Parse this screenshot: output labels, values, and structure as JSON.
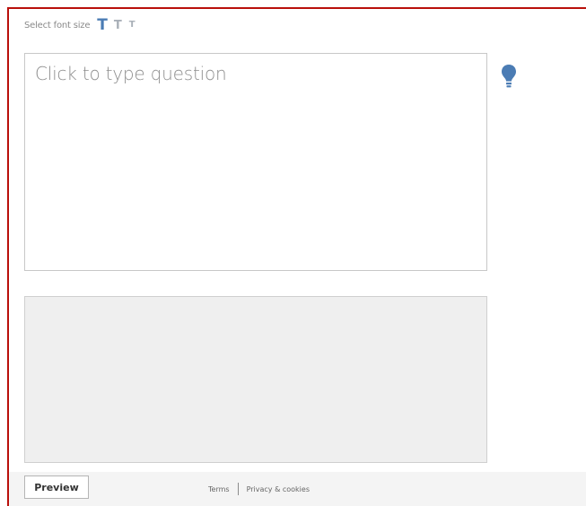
{
  "font_size": {
    "label": "Select font size",
    "large": "T",
    "medium": "T",
    "small": "T"
  },
  "question": {
    "placeholder": "Click to type question"
  },
  "icons": {
    "hint": "lightbulb-icon"
  },
  "colors": {
    "frame_border": "#b9100b",
    "accent": "#4b7cb4",
    "answer_area_bg": "#efefef"
  },
  "footer": {
    "preview_label": "Preview",
    "terms_label": "Terms",
    "privacy_label": "Privacy & cookies"
  }
}
